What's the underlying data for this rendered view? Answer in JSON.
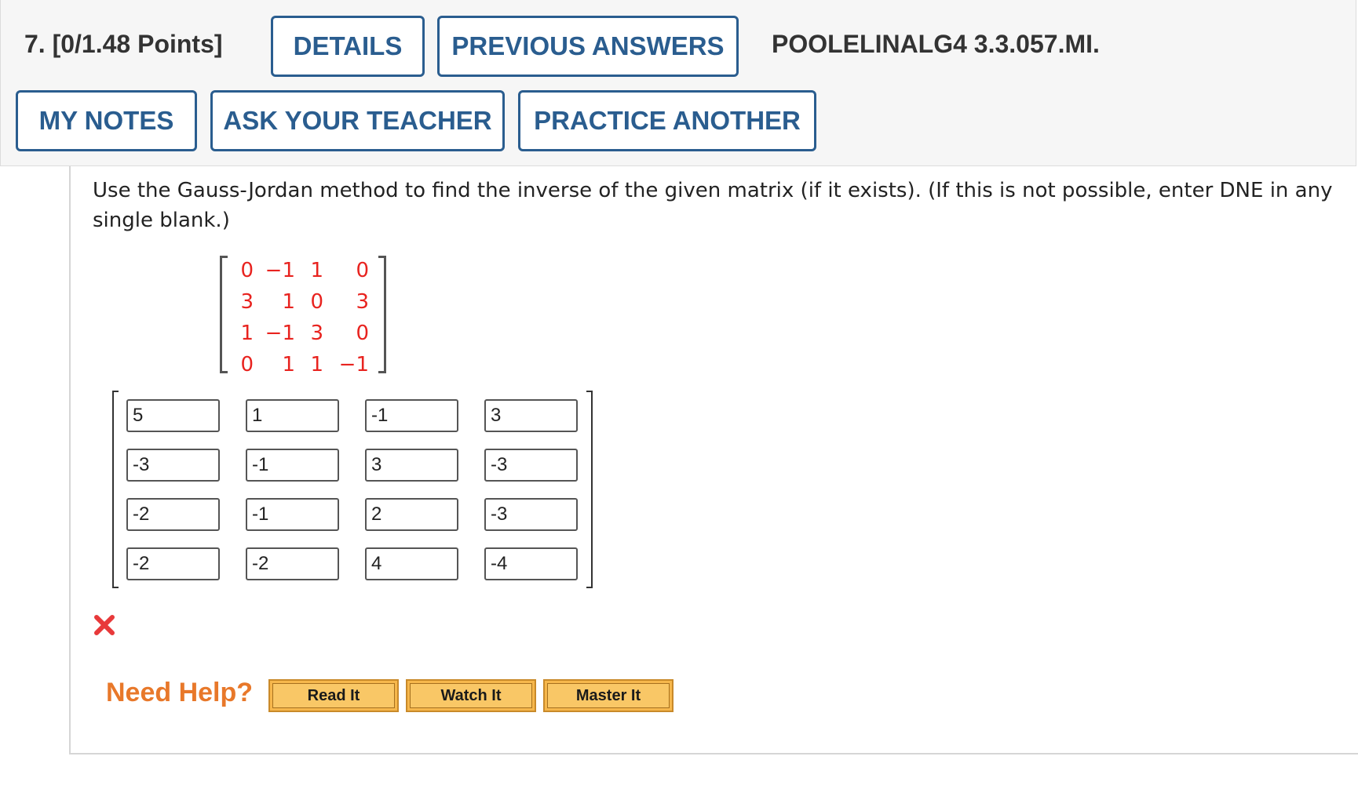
{
  "header": {
    "question_label": "7.  [0/1.48 Points]",
    "details_label": "DETAILS",
    "previous_answers_label": "PREVIOUS ANSWERS",
    "reference": "POOLELINALG4 3.3.057.MI.",
    "my_notes_label": "MY NOTES",
    "ask_teacher_label": "ASK YOUR TEACHER",
    "practice_another_label": "PRACTICE ANOTHER"
  },
  "prompt": "Use the Gauss-Jordan method to find the inverse of the given matrix (if it exists). (If this is not possible, enter DNE in any single blank.)",
  "given_matrix": [
    [
      "0",
      "−1",
      "1",
      "0"
    ],
    [
      "3",
      "1",
      "0",
      "3"
    ],
    [
      "1",
      "−1",
      "3",
      "0"
    ],
    [
      "0",
      "1",
      "1",
      "−1"
    ]
  ],
  "answer_matrix": [
    [
      "5",
      "1",
      "-1",
      "3"
    ],
    [
      "-3",
      "-1",
      "3",
      "-3"
    ],
    [
      "-2",
      "-1",
      "2",
      "-3"
    ],
    [
      "-2",
      "-2",
      "4",
      "-4"
    ]
  ],
  "status": {
    "icon": "incorrect-x-icon",
    "color": "#e8393a"
  },
  "help": {
    "label": "Need Help?",
    "read_it": "Read It",
    "watch_it": "Watch It",
    "master_it": "Master It"
  },
  "colors": {
    "accent": "#2a5d8f",
    "matrix_text": "#e8231f",
    "help_label": "#e8782a",
    "help_button": "#f6b74c"
  }
}
